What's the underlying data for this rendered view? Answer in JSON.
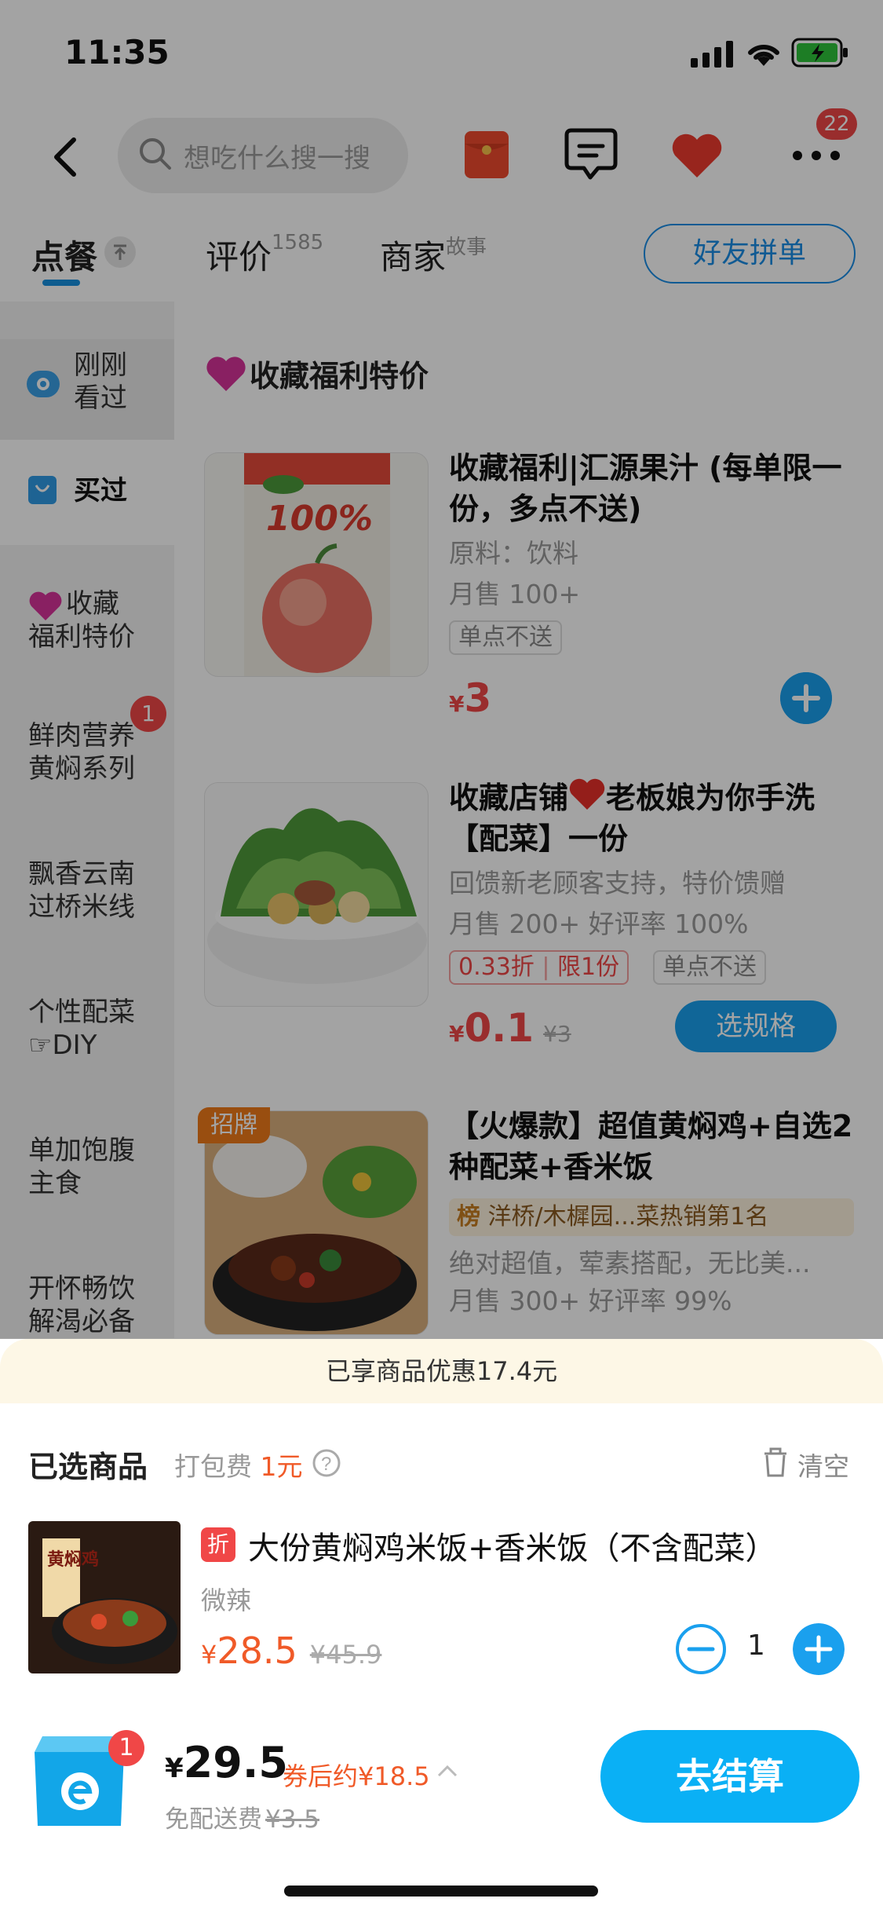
{
  "status": {
    "time": "11:35"
  },
  "search": {
    "placeholder": "想吃什么搜一搜"
  },
  "header": {
    "message_badge": "22"
  },
  "tabs": [
    {
      "label": "点餐",
      "sub": ""
    },
    {
      "label": "评价",
      "sub": "1585"
    },
    {
      "label": "商家",
      "sub": "故事"
    }
  ],
  "group_order_label": "好友拼单",
  "sidebar": {
    "items": [
      {
        "label_1": "刚刚",
        "label_2": "看过"
      },
      {
        "label_1": "买过",
        "label_2": ""
      },
      {
        "label_1": "收藏",
        "label_2": "福利特价"
      },
      {
        "label_1": "鲜肉营养",
        "label_2": "黄焖系列",
        "badge": "1"
      },
      {
        "label_1": "飘香云南",
        "label_2": "过桥米线"
      },
      {
        "label_1": "个性配菜",
        "label_2": "☞DIY"
      },
      {
        "label_1": "单加饱腹",
        "label_2": "主食"
      },
      {
        "label_1": "开怀畅饮",
        "label_2": "解渴必备"
      }
    ]
  },
  "section_title": "收藏福利特价",
  "products": [
    {
      "title": "收藏福利|汇源果汁 (每单限一份，多点不送)",
      "desc": "原料：饮料",
      "sales": "月售 100+",
      "tag": "单点不送",
      "currency": "¥",
      "price": "3"
    },
    {
      "title_a": "收藏店铺",
      "title_b": "老板娘为你手洗【配菜】一份",
      "desc": "回馈新老顾客支持，特价馈赠",
      "sales": "月售 200+ 好评率 100%",
      "discount_tag": "0.33折",
      "limit_tag": "限1份",
      "tag": "单点不送",
      "currency": "¥",
      "price": "0.1",
      "old_price": "¥3",
      "button": "选规格"
    },
    {
      "badge": "招牌",
      "title": "【火爆款】超值黄焖鸡+自选2种配菜+香米饭",
      "rank_icon": "榜",
      "rank": "洋桥/木樨园...菜热销第1名",
      "desc": "绝对超值，荤素搭配，无比美...",
      "sales": "月售 300+ 好评率 99%"
    }
  ],
  "cart": {
    "discount_banner": "已享商品优惠17.4元",
    "selected_title": "已选商品",
    "pack_fee_label": "打包费",
    "pack_fee_value": "1元",
    "clear_label": "清空",
    "item": {
      "discount_icon": "折",
      "title": "大份黄焖鸡米饭+香米饭（不含配菜）",
      "spec": "微辣",
      "currency": "¥",
      "price": "28.5",
      "old_price": "¥45.9",
      "quantity": "1",
      "image_text": "黄焖鸡"
    },
    "badge": "1",
    "total_currency": "¥",
    "total": "29.5",
    "coupon_text": "券后约¥18.5",
    "delivery_label": "免配送费",
    "delivery_old": "¥3.5",
    "checkout_label": "去结算"
  },
  "colors": {
    "accent": "#0ab0f5",
    "price": "#f05a28",
    "badge": "#f04747"
  }
}
